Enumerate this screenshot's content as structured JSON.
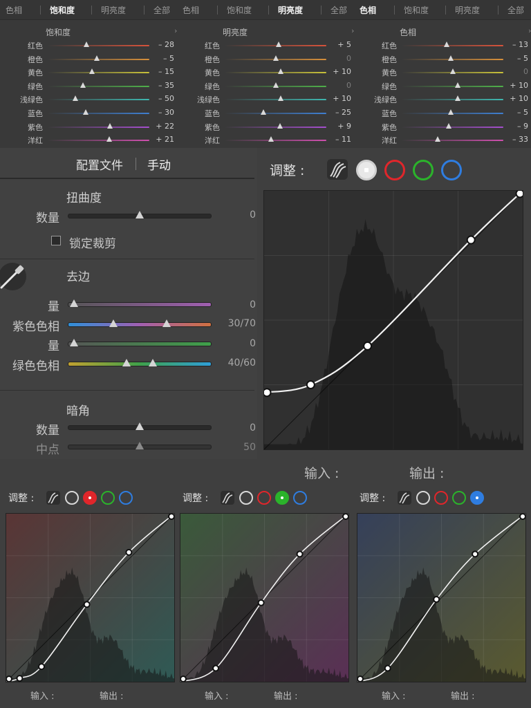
{
  "hsl_panels": [
    {
      "tabs": [
        "色相",
        "饱和度",
        "明亮度",
        "全部"
      ],
      "active_tab": "饱和度",
      "title": "饱和度",
      "rows": [
        {
          "label": "红色",
          "value": "– 28",
          "pos": 0.38
        },
        {
          "label": "橙色",
          "value": "– 5",
          "pos": 0.48
        },
        {
          "label": "黄色",
          "value": "– 15",
          "pos": 0.43
        },
        {
          "label": "绿色",
          "value": "– 35",
          "pos": 0.34
        },
        {
          "label": "浅绿色",
          "value": "– 50",
          "pos": 0.27
        },
        {
          "label": "蓝色",
          "value": "– 30",
          "pos": 0.37
        },
        {
          "label": "紫色",
          "value": "+ 22",
          "pos": 0.61
        },
        {
          "label": "洋红",
          "value": "+ 21",
          "pos": 0.6
        }
      ]
    },
    {
      "tabs": [
        "色相",
        "饱和度",
        "明亮度",
        "全部"
      ],
      "active_tab": "明亮度",
      "title": "明亮度",
      "rows": [
        {
          "label": "红色",
          "value": "+ 5",
          "pos": 0.53
        },
        {
          "label": "橙色",
          "value": "0",
          "pos": 0.5
        },
        {
          "label": "黄色",
          "value": "+ 10",
          "pos": 0.55
        },
        {
          "label": "绿色",
          "value": "0",
          "pos": 0.5
        },
        {
          "label": "浅绿色",
          "value": "+ 10",
          "pos": 0.55
        },
        {
          "label": "蓝色",
          "value": "– 25",
          "pos": 0.38
        },
        {
          "label": "紫色",
          "value": "+ 9",
          "pos": 0.54
        },
        {
          "label": "洋红",
          "value": "– 11",
          "pos": 0.45
        }
      ]
    },
    {
      "tabs": [
        "色相",
        "饱和度",
        "明亮度",
        "全部"
      ],
      "active_tab": "色相",
      "title": "色相",
      "rows": [
        {
          "label": "红色",
          "value": "– 13",
          "pos": 0.44
        },
        {
          "label": "橙色",
          "value": "– 5",
          "pos": 0.48
        },
        {
          "label": "黄色",
          "value": "0",
          "pos": 0.5
        },
        {
          "label": "绿色",
          "value": "+ 10",
          "pos": 0.55
        },
        {
          "label": "浅绿色",
          "value": "+ 10",
          "pos": 0.55
        },
        {
          "label": "蓝色",
          "value": "– 5",
          "pos": 0.48
        },
        {
          "label": "紫色",
          "value": "– 9",
          "pos": 0.46
        },
        {
          "label": "洋红",
          "value": "– 33",
          "pos": 0.35
        }
      ]
    }
  ],
  "hsl_track_colors": [
    [
      "#3a3a3a",
      "#d8533b"
    ],
    [
      "#3a3a3a",
      "#d8903b"
    ],
    [
      "#3a3a3a",
      "#c9c23a"
    ],
    [
      "#3a3a3a",
      "#4fb04a"
    ],
    [
      "#3a3a3a",
      "#3fb8b0"
    ],
    [
      "#3a3a3a",
      "#3f7fd1"
    ],
    [
      "#3a3a3a",
      "#a64fcf"
    ],
    [
      "#3a3a3a",
      "#cf4fae"
    ]
  ],
  "lens": {
    "tab_profile": "配置文件",
    "tab_manual": "手动",
    "distortion": {
      "title": "扭曲度",
      "amount_label": "数量",
      "amount_value": "0",
      "lock_crop_label": "锁定裁剪"
    },
    "defringe": {
      "title": "去边",
      "purple_amount_label": "量",
      "purple_amount_value": "0",
      "purple_hue_label": "紫色色相",
      "purple_hue_value": "30/70",
      "green_amount_label": "量",
      "green_amount_value": "0",
      "green_hue_label": "绿色色相",
      "green_hue_value": "40/60"
    },
    "vignette": {
      "title": "暗角",
      "amount_label": "数量",
      "amount_value": "0",
      "midpoint_label": "中点",
      "midpoint_value": "50"
    }
  },
  "main_curve": {
    "adjust_label": "调整 :",
    "input_label": "输入 :",
    "output_label": "输出 :",
    "points": [
      [
        0,
        0.22
      ],
      [
        0.18,
        0.25
      ],
      [
        0.4,
        0.4
      ],
      [
        0.8,
        0.81
      ],
      [
        1.0,
        1.0
      ]
    ]
  },
  "channel_curves": [
    {
      "adjust_label": "调整 :",
      "input_label": "输入 :",
      "output_label": "输出 :",
      "active": "red",
      "points": [
        [
          0,
          0
        ],
        [
          0.08,
          0.02
        ],
        [
          0.21,
          0.09
        ],
        [
          0.48,
          0.46
        ],
        [
          0.73,
          0.77
        ],
        [
          1.0,
          1.0
        ]
      ],
      "tint_start": "#5a3535",
      "tint_end": "#2f5a55"
    },
    {
      "adjust_label": "调整 :",
      "input_label": "输入 :",
      "output_label": "输出 :",
      "active": "green",
      "points": [
        [
          0,
          0
        ],
        [
          0.21,
          0.08
        ],
        [
          0.48,
          0.47
        ],
        [
          0.71,
          0.76
        ],
        [
          1.0,
          1.0
        ]
      ],
      "tint_start": "#3a5a3a",
      "tint_end": "#5a2f55"
    },
    {
      "adjust_label": "调整 :",
      "input_label": "输入 :",
      "output_label": "输出 :",
      "active": "blue",
      "points": [
        [
          0,
          0
        ],
        [
          0.18,
          0.08
        ],
        [
          0.47,
          0.49
        ],
        [
          0.7,
          0.76
        ],
        [
          1.0,
          1.0
        ]
      ],
      "tint_start": "#35405a",
      "tint_end": "#5a5a2f"
    }
  ],
  "colors": {
    "red": "#e0262b",
    "green": "#2bb32b",
    "blue": "#2f7de0"
  }
}
